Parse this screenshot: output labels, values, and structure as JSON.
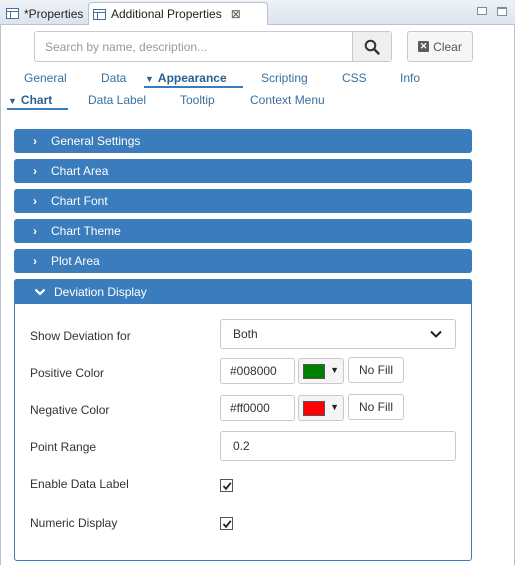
{
  "tabs": {
    "properties": "*Properties",
    "additional": "Additional Properties",
    "close_glyph": "⊠"
  },
  "search": {
    "placeholder": "Search by name, description...",
    "value": ""
  },
  "clear_label": "Clear",
  "nav_top": [
    {
      "label": "General"
    },
    {
      "label": "Data"
    },
    {
      "label": "Appearance",
      "active": true
    },
    {
      "label": "Scripting"
    },
    {
      "label": "CSS"
    },
    {
      "label": "Info"
    }
  ],
  "nav_sub": [
    {
      "label": "Chart",
      "active": true
    },
    {
      "label": "Data Label"
    },
    {
      "label": "Tooltip"
    },
    {
      "label": "Context Menu"
    }
  ],
  "sections": [
    {
      "label": "General Settings"
    },
    {
      "label": "Chart Area"
    },
    {
      "label": "Chart Font"
    },
    {
      "label": "Chart Theme"
    },
    {
      "label": "Plot Area"
    }
  ],
  "deviation": {
    "title": "Deviation Display",
    "show_for_label": "Show Deviation for",
    "show_for_value": "Both",
    "positive_label": "Positive Color",
    "positive_value": "#008000",
    "negative_label": "Negative Color",
    "negative_value": "#ff0000",
    "no_fill_label": "No Fill",
    "point_range_label": "Point Range",
    "point_range_value": "0.2",
    "enable_label": "Enable Data Label",
    "enable_checked": true,
    "numeric_label": "Numeric Display",
    "numeric_checked": true
  },
  "colors": {
    "accent": "#3a7cbc",
    "positive": "#008000",
    "negative": "#ff0000"
  }
}
